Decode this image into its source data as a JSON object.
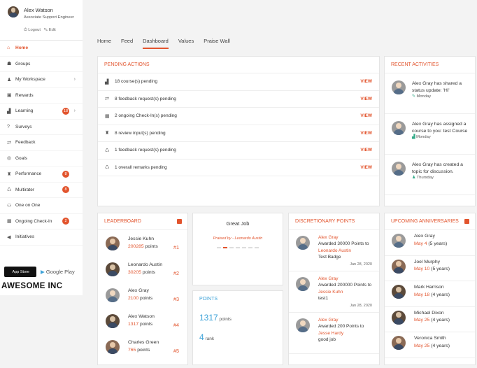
{
  "user": {
    "name": "Alex Watson",
    "title": "Associate Support Engineer",
    "logout": "Logout",
    "edit": "Edit"
  },
  "nav": [
    {
      "label": "Home",
      "icon": "home-icon",
      "glyph": "⌂",
      "active": true,
      "badge": "",
      "chevron": false
    },
    {
      "label": "Groups",
      "icon": "groups-icon",
      "glyph": "☗",
      "active": false,
      "badge": "",
      "chevron": false
    },
    {
      "label": "My Workspace",
      "icon": "user-icon",
      "glyph": "♟",
      "active": false,
      "badge": "",
      "chevron": true
    },
    {
      "label": "Rewards",
      "icon": "gift-icon",
      "glyph": "▣",
      "active": false,
      "badge": "",
      "chevron": false
    },
    {
      "label": "Learning",
      "icon": "learning-icon",
      "glyph": "▟",
      "active": false,
      "badge": "18",
      "chevron": true
    },
    {
      "label": "Surveys",
      "icon": "question-icon",
      "glyph": "?",
      "active": false,
      "badge": "",
      "chevron": false
    },
    {
      "label": "Feedback",
      "icon": "exchange-icon",
      "glyph": "⇄",
      "active": false,
      "badge": "",
      "chevron": false
    },
    {
      "label": "Goals",
      "icon": "target-icon",
      "glyph": "◎",
      "active": false,
      "badge": "",
      "chevron": false
    },
    {
      "label": "Performance",
      "icon": "trophy-icon",
      "glyph": "♜",
      "active": false,
      "badge": "8",
      "chevron": false
    },
    {
      "label": "Multirater",
      "icon": "recycle-icon",
      "glyph": "♺",
      "active": false,
      "badge": "8",
      "chevron": false
    },
    {
      "label": "One on One",
      "icon": "people-icon",
      "glyph": "⚇",
      "active": false,
      "badge": "",
      "chevron": false
    },
    {
      "label": "Ongoing Check-In",
      "icon": "calendar-icon",
      "glyph": "▦",
      "active": false,
      "badge": "2",
      "chevron": false
    },
    {
      "label": "Initiatives",
      "icon": "megaphone-icon",
      "glyph": "◀",
      "active": false,
      "badge": "",
      "chevron": false
    }
  ],
  "stores": {
    "apple": "App Store",
    "google": "Google Play"
  },
  "company": "AWESOME INC",
  "tabs": [
    {
      "label": "Home",
      "active": false
    },
    {
      "label": "Feed",
      "active": false
    },
    {
      "label": "Dashboard",
      "active": true
    },
    {
      "label": "Values",
      "active": false
    },
    {
      "label": "Praise Wall",
      "active": false
    }
  ],
  "pending": {
    "title": "PENDING ACTIONS",
    "view_label": "VIEW",
    "rows": [
      {
        "text": "18 course(s) pending",
        "icon": "learning-icon",
        "glyph": "▟"
      },
      {
        "text": "8 feedback request(s) pending",
        "icon": "exchange-icon",
        "glyph": "⇄"
      },
      {
        "text": "2 ongoing Check-In(s) pending",
        "icon": "calendar-icon",
        "glyph": "▦"
      },
      {
        "text": "8 review input(s) pending",
        "icon": "trophy-icon",
        "glyph": "♜"
      },
      {
        "text": "1 feedback request(s) pending",
        "icon": "recycle-icon",
        "glyph": "♺"
      },
      {
        "text": "1 overall remarks pending",
        "icon": "recycle-icon",
        "glyph": "♺"
      }
    ]
  },
  "recent": {
    "title": "RECENT ACTIVITIES",
    "items": [
      {
        "text": "Alex Gray has shared a status update: 'Hi'",
        "day": "Monday",
        "icon": "edit-icon",
        "glyph": "✎"
      },
      {
        "text": "Alex Gray has assigned a course to you: test Course",
        "day": "Monday",
        "icon": "learning-icon",
        "glyph": "▟"
      },
      {
        "text": "Alex Gray has created a topic for discussion.",
        "day": "Thursday",
        "icon": "user-icon",
        "glyph": "♟"
      }
    ]
  },
  "leaderboard": {
    "title": "LEADERBOARD",
    "unit": "points",
    "rows": [
      {
        "name": "Jessie Kuhn",
        "points": "200285",
        "rank": "#1"
      },
      {
        "name": "Leonardo Austin",
        "points": "30205",
        "rank": "#2"
      },
      {
        "name": "Alex Gray",
        "points": "2100",
        "rank": "#3"
      },
      {
        "name": "Alex Watson",
        "points": "1317",
        "rank": "#4"
      },
      {
        "name": "Charles Green",
        "points": "765",
        "rank": "#5"
      }
    ]
  },
  "praise": {
    "title": "Great Job",
    "praised_by": "Praised by - Leonardo Austin",
    "dots": 7,
    "active_dot": 1
  },
  "points": {
    "title": "POINTS",
    "points_value": "1317",
    "points_label": "points",
    "rank_value": "4",
    "rank_label": "rank"
  },
  "discretionary": {
    "title": "DISCRETIONARY POINTS",
    "items": [
      {
        "giver": "Alex Gray",
        "action": "Awarded 30000 Points to",
        "receiver": "Leonardo Austin",
        "tail": "Test Badge",
        "date": "Jan 28, 2020"
      },
      {
        "giver": "Alex Gray",
        "action": "Awarded 200000 Points to",
        "receiver": "Jessie Kuhn",
        "tail": "test1",
        "date": "Jan 28, 2020"
      },
      {
        "giver": "Alex Gray",
        "action": "Awarded 200 Points to",
        "receiver": "Jesse Hardy",
        "tail": "good job",
        "date": ""
      }
    ]
  },
  "anniversaries": {
    "title": "UPCOMING ANNIVERSARIES",
    "items": [
      {
        "name": "Alex Gray",
        "date": "May 4",
        "years": "(5 years)"
      },
      {
        "name": "Joel Murphy",
        "date": "May 10",
        "years": "(5 years)"
      },
      {
        "name": "Mark Harrison",
        "date": "May 18",
        "years": "(4 years)"
      },
      {
        "name": "Michael Dixon",
        "date": "May 25",
        "years": "(4 years)"
      },
      {
        "name": "Veronica Smith",
        "date": "May 25",
        "years": "(4 years)"
      }
    ]
  },
  "colors": {
    "accent": "#e2542d",
    "link_blue": "#3ca2d8"
  }
}
